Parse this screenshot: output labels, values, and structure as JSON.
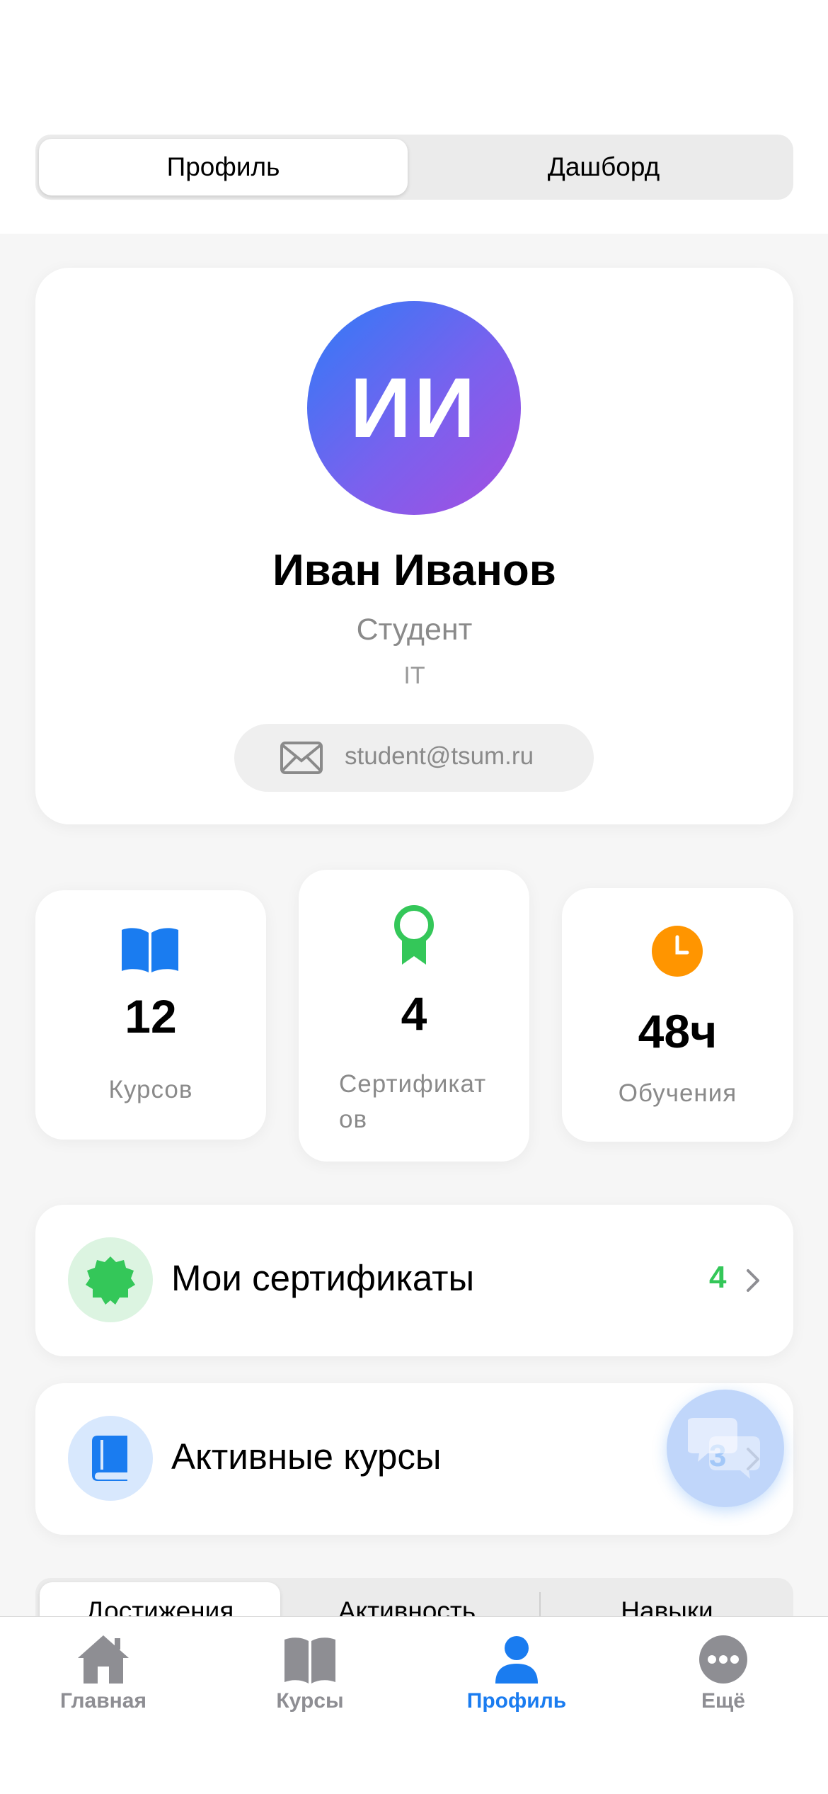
{
  "segment": {
    "options": [
      "Профиль",
      "Дашборд"
    ],
    "selected": "Профиль"
  },
  "profile": {
    "initials": "ИИ",
    "name": "Иван Иванов",
    "role": "Студент",
    "department": "IT",
    "email": "student@tsum.ru"
  },
  "stats": [
    {
      "value": "12",
      "label": "Курсов",
      "icon": "book-icon",
      "color": "#1a7cf0"
    },
    {
      "value": "4",
      "label_line1": "Сертификат",
      "label_line2": "ов",
      "icon": "award-icon",
      "color": "#34c759"
    },
    {
      "value": "48ч",
      "label": "Обучения",
      "icon": "clock-icon",
      "color": "#ff9500"
    }
  ],
  "rows": [
    {
      "title": "Мои сертификаты",
      "count": "4",
      "count_color": "#34c759",
      "icon": "seal-icon"
    },
    {
      "title": "Активные курсы",
      "count": "3",
      "count_color": "#1a7cf0",
      "icon": "book-icon"
    }
  ],
  "bottom_tabs_partial": [
    "Достижения",
    "Активность",
    "Навыки"
  ],
  "tabbar": [
    {
      "label": "Главная",
      "icon": "house-icon"
    },
    {
      "label": "Курсы",
      "icon": "book-open-icon"
    },
    {
      "label": "Профиль",
      "icon": "person-icon",
      "active": true
    },
    {
      "label": "Ещё",
      "icon": "more-icon"
    }
  ],
  "colors": {
    "accent": "#1a7cf0",
    "green": "#34c759",
    "orange": "#ff9500"
  }
}
